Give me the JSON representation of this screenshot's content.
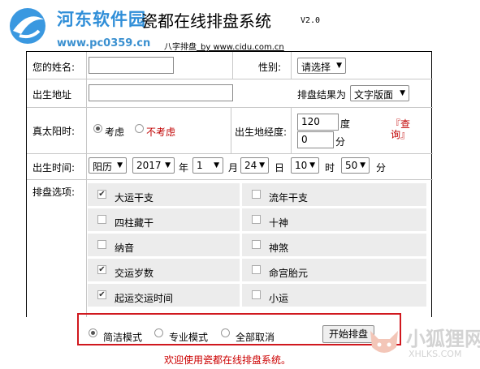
{
  "watermark": {
    "site_name": "河东软件园",
    "site_url": "www.pc0359.cn",
    "corner_brand": "小狐狸网",
    "corner_url": "XHLKS.COM"
  },
  "header": {
    "title": "瓷都在线排盘系统",
    "version": "V2.0",
    "subtitle_prefix": "八字排盘",
    "subtitle_by": "_by www.cidu.com.cn"
  },
  "form": {
    "name_label": "您的姓名:",
    "name_value": "",
    "gender_label": "性别:",
    "gender_value": "请选择",
    "birthplace_label": "出生地址",
    "birthplace_value": "",
    "result_label": "排盘结果为",
    "result_value": "文字版面",
    "solar_label": "真太阳时:",
    "solar_yes": "考虑",
    "solar_no": "不考虑",
    "longitude_label": "出生地经度:",
    "longitude_deg": "120",
    "deg_unit": "度",
    "longitude_min": "0",
    "min_unit": "分",
    "lookup_link": "『查询』",
    "birthtime_label": "出生时间:",
    "calendar_value": "阳历",
    "year_value": "2017",
    "year_unit": "年",
    "month_value": "1",
    "month_unit": "月",
    "day_value": "24",
    "day_unit": "日",
    "hour_value": "10",
    "hour_unit": "时",
    "minute_value": "50",
    "minute_unit": "分",
    "options_label": "排盘选项:"
  },
  "options": [
    {
      "label": "大运干支",
      "checked": true
    },
    {
      "label": "流年干支",
      "checked": false
    },
    {
      "label": "四柱藏干",
      "checked": false
    },
    {
      "label": "十神",
      "checked": false
    },
    {
      "label": "纳音",
      "checked": false
    },
    {
      "label": "神煞",
      "checked": false
    },
    {
      "label": "交运岁数",
      "checked": true
    },
    {
      "label": "命宫胎元",
      "checked": false
    },
    {
      "label": "起运交运时间",
      "checked": true
    },
    {
      "label": "小运",
      "checked": false
    }
  ],
  "mode": {
    "simple": "简洁模式",
    "pro": "专业模式",
    "clear": "全部取消",
    "start_button": "开始排盘"
  },
  "footer": {
    "welcome": "欢迎使用瓷都在线排盘系统。"
  },
  "colors": {
    "link_red": "#c00000",
    "highlight_box": "#d0181e",
    "logo_blue": "#2f8ed8"
  }
}
